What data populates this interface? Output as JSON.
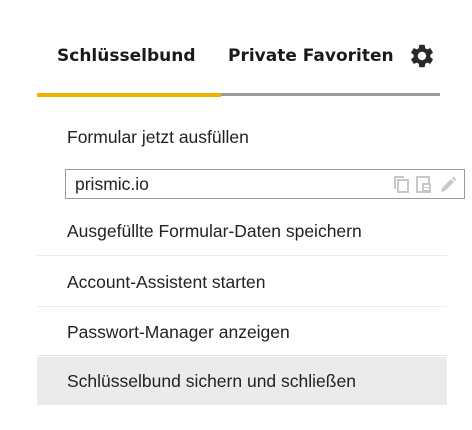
{
  "tabs": {
    "keychain": "Schlüsselbund",
    "private_favorites": "Private Favoriten",
    "settings_icon": "gear-icon"
  },
  "menu": {
    "fill_form": "Formular jetzt ausfüllen",
    "url_field_value": "prismic.io",
    "save_form_data": "Ausgefüllte Formular-Daten speichern",
    "account_assistant": "Account-Assistent starten",
    "password_manager": "Passwort-Manager anzeigen",
    "lock_keychain": "Schlüsselbund sichern und schließen"
  },
  "field_icons": [
    "copy-icon",
    "paste-icon",
    "edit-icon"
  ],
  "colors": {
    "active_tab_underline": "#f0b400",
    "tab_underline": "#9a9a9a",
    "highlight_row": "#ebebeb",
    "disabled_icon": "#c8c8c8"
  }
}
